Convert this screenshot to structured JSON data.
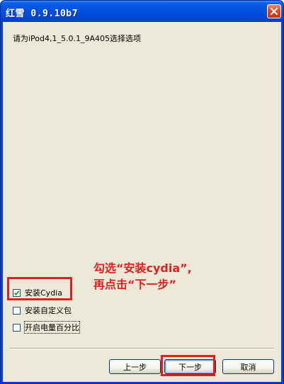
{
  "window": {
    "title": "红雪 0.9.10b7"
  },
  "prompt": "请为iPod4,1_5.0.1_9A405选择选项",
  "options": [
    {
      "label": "安装Cydia",
      "checked": true
    },
    {
      "label": "安装自定义包",
      "checked": false
    },
    {
      "label": "开启电量百分比",
      "checked": false
    }
  ],
  "annotation": {
    "line1": "勾选“安装cydia”,",
    "line2": "再点击“下一步”",
    "color": "#e02020"
  },
  "buttons": {
    "back": "上一步",
    "next": "下一步",
    "cancel": "取消"
  },
  "icons": {
    "close": "close-icon",
    "check": "checkmark-icon"
  }
}
